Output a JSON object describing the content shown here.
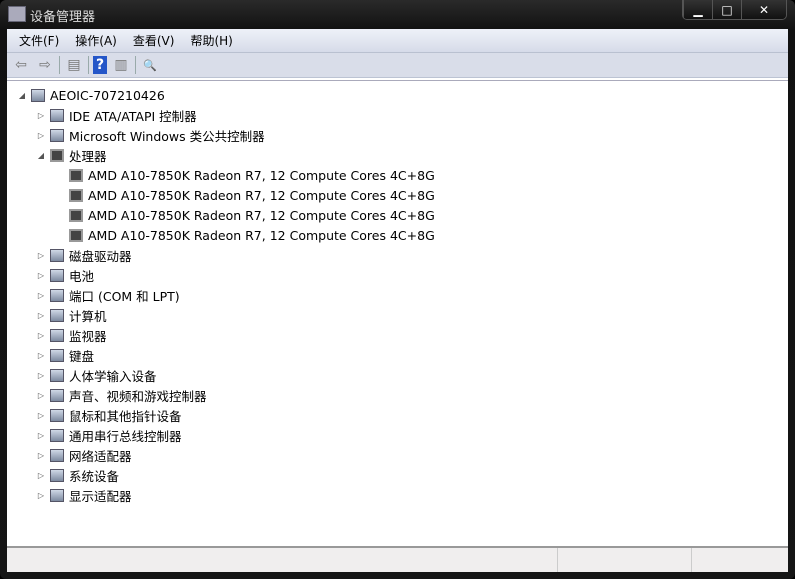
{
  "window": {
    "title": "设备管理器",
    "controls": {
      "minimize": "▁",
      "maximize": "□",
      "close": "✕"
    }
  },
  "menu": [
    "文件(F)",
    "操作(A)",
    "查看(V)",
    "帮助(H)"
  ],
  "toolbar": {
    "back": "⇦",
    "forward": "⇨",
    "properties": "▤",
    "help": "?",
    "update": "▥",
    "scan": "🔍"
  },
  "tree": {
    "root": "AEOIC-707210426",
    "items": [
      {
        "label": "IDE ATA/ATAPI 控制器",
        "expanded": false
      },
      {
        "label": "Microsoft Windows 类公共控制器",
        "expanded": false
      },
      {
        "label": "处理器",
        "expanded": true,
        "children": [
          "AMD A10-7850K Radeon R7, 12 Compute Cores 4C+8G",
          "AMD A10-7850K Radeon R7, 12 Compute Cores 4C+8G",
          "AMD A10-7850K Radeon R7, 12 Compute Cores 4C+8G",
          "AMD A10-7850K Radeon R7, 12 Compute Cores 4C+8G"
        ]
      },
      {
        "label": "磁盘驱动器",
        "expanded": false
      },
      {
        "label": "电池",
        "expanded": false
      },
      {
        "label": "端口 (COM 和 LPT)",
        "expanded": false
      },
      {
        "label": "计算机",
        "expanded": false
      },
      {
        "label": "监视器",
        "expanded": false
      },
      {
        "label": "键盘",
        "expanded": false
      },
      {
        "label": "人体学输入设备",
        "expanded": false
      },
      {
        "label": "声音、视频和游戏控制器",
        "expanded": false
      },
      {
        "label": "鼠标和其他指针设备",
        "expanded": false
      },
      {
        "label": "通用串行总线控制器",
        "expanded": false
      },
      {
        "label": "网络适配器",
        "expanded": false
      },
      {
        "label": "系统设备",
        "expanded": false
      },
      {
        "label": "显示适配器",
        "expanded": false
      }
    ]
  }
}
